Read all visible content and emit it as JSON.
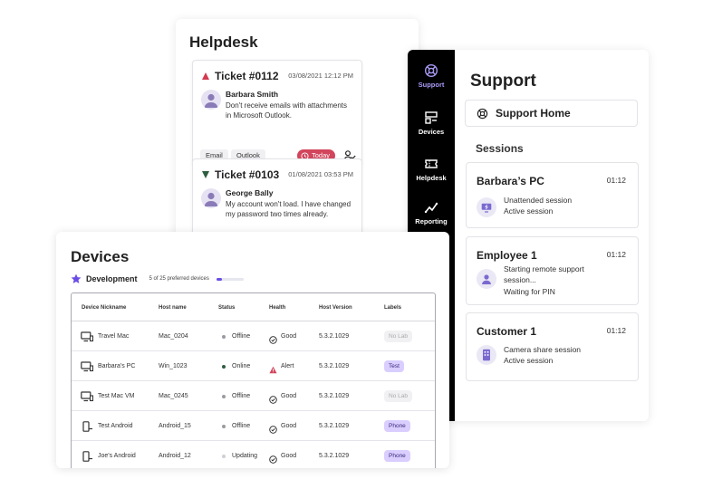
{
  "helpdesk": {
    "title": "Helpdesk",
    "tickets": [
      {
        "title": "Ticket #0112",
        "date": "03/08/2021 12:12 PM",
        "priority": "high",
        "name": "Barbara Smith",
        "message": "Don't receive emails with attachments in Microsoft Outlook.",
        "tags": [
          "Email",
          "Outlook"
        ],
        "due": "Today"
      },
      {
        "title": "Ticket #0103",
        "date": "01/08/2021 03:53 PM",
        "priority": "low",
        "name": "George Bally",
        "message": "My account won't load. I have changed my password two times already."
      }
    ]
  },
  "support": {
    "title": "Support",
    "nav": [
      {
        "label": "Support",
        "icon": "lifebuoy-icon",
        "active": true
      },
      {
        "label": "Devices",
        "icon": "devices-icon",
        "active": false
      },
      {
        "label": "Helpdesk",
        "icon": "ticket-icon",
        "active": false
      },
      {
        "label": "Reporting",
        "icon": "chart-line-icon",
        "active": false
      }
    ],
    "home_button": "Support Home",
    "sessions_label": "Sessions",
    "sessions": [
      {
        "name": "Barbara’s PC",
        "time": "01:12",
        "line1": "Unattended session",
        "line2": "Active session",
        "icon": "monitor-icon"
      },
      {
        "name": "Employee 1",
        "time": "01:12",
        "line1": "Starting remote support session...",
        "line2": "Waiting for PIN",
        "icon": "user-icon"
      },
      {
        "name": "Customer 1",
        "time": "01:12",
        "line1": "Camera share session",
        "line2": "Active session",
        "icon": "phone-icon"
      }
    ]
  },
  "devices": {
    "title": "Devices",
    "group": "Development",
    "count": "5 of 25 preferred devices",
    "count_fraction": 0.2,
    "columns": [
      "Device Nickname",
      "Host name",
      "Status",
      "Health",
      "Host Version",
      "Labels"
    ],
    "rows": [
      {
        "nickname": "Travel Mac",
        "type": "desktop",
        "host": "Mac_0204",
        "status": "Offline",
        "health": "Good",
        "version": "5.3.2.1029",
        "label": "No Lab",
        "label_style": "none"
      },
      {
        "nickname": "Barbara's PC",
        "type": "desktop",
        "host": "Win_1023",
        "status": "Online",
        "health": "Alert",
        "version": "5.3.2.1029",
        "label": "Test",
        "label_style": "col"
      },
      {
        "nickname": "Test Mac VM",
        "type": "desktop",
        "host": "Mac_0245",
        "status": "Offline",
        "health": "Good",
        "version": "5.3.2.1029",
        "label": "No Lab",
        "label_style": "none"
      },
      {
        "nickname": "Test Android",
        "type": "mobile",
        "host": "Android_15",
        "status": "Offline",
        "health": "Good",
        "version": "5.3.2.1029",
        "label": "Phone",
        "label_style": "col"
      },
      {
        "nickname": "Joe's Android",
        "type": "mobile",
        "host": "Android_12",
        "status": "Updating",
        "health": "Good",
        "version": "5.3.2.1029",
        "label": "Phone",
        "label_style": "col"
      }
    ]
  },
  "colors": {
    "accent": "#6b4de6",
    "alert": "#d2455c",
    "online": "#2e5e3e",
    "offline": "#9a9aa2",
    "updating": "#cfcfd6"
  }
}
